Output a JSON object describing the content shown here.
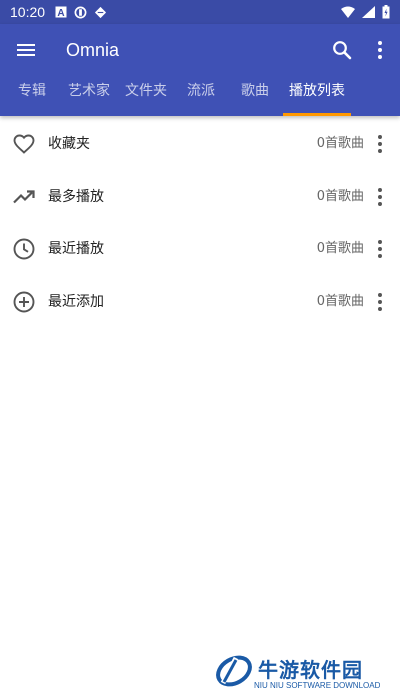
{
  "status_bar": {
    "time": "10:20"
  },
  "toolbar": {
    "title": "Omnia",
    "icons": [
      "menu-icon",
      "search-icon",
      "more-vert-icon"
    ]
  },
  "tabs": [
    {
      "label": "专辑",
      "active": false
    },
    {
      "label": "艺术家",
      "active": false
    },
    {
      "label": "文件夹",
      "active": false
    },
    {
      "label": "流派",
      "active": false
    },
    {
      "label": "歌曲",
      "active": false
    },
    {
      "label": "播放列表",
      "active": true
    }
  ],
  "playlists": [
    {
      "name": "收藏夹",
      "count": "0首歌曲",
      "icon": "heart-icon"
    },
    {
      "name": "最多播放",
      "count": "0首歌曲",
      "icon": "trending-up-icon"
    },
    {
      "name": "最近播放",
      "count": "0首歌曲",
      "icon": "clock-icon"
    },
    {
      "name": "最近添加",
      "count": "0首歌曲",
      "icon": "add-circle-icon"
    }
  ],
  "watermark": {
    "title": "牛游软件园",
    "subtitle": "NIU NIU SOFTWARE DOWNLOAD"
  },
  "colors": {
    "primary": "#3f51b5",
    "status_bar": "#3a4ba6",
    "accent": "#ff9800"
  }
}
